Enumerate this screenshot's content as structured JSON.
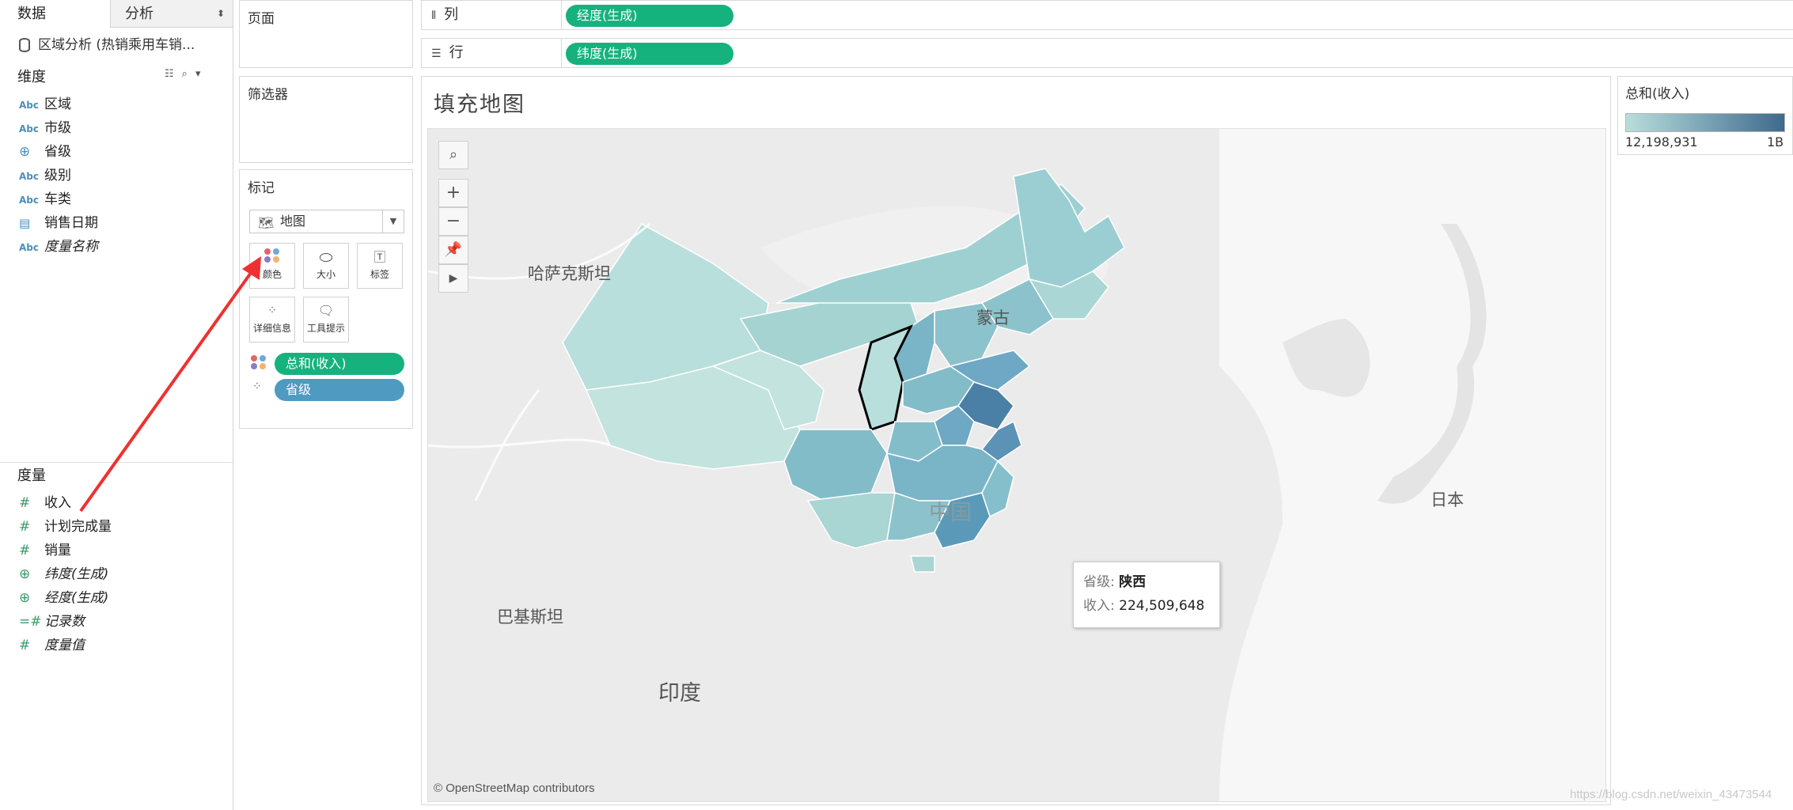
{
  "data_pane": {
    "tabs": [
      {
        "label": "数据"
      },
      {
        "label": "分析"
      }
    ],
    "datasource": "区域分析 (热销乘用车销...",
    "dimensions_title": "维度",
    "dimensions": [
      {
        "type": "Abc",
        "label": "区域"
      },
      {
        "type": "Abc",
        "label": "市级"
      },
      {
        "type": "geo",
        "label": "省级"
      },
      {
        "type": "Abc",
        "label": "级别"
      },
      {
        "type": "Abc",
        "label": "车类"
      },
      {
        "type": "date",
        "label": "销售日期"
      },
      {
        "type": "Abc",
        "label": "度量名称"
      }
    ],
    "measures_title": "度量",
    "measures": [
      {
        "type": "#",
        "label": "收入"
      },
      {
        "type": "#",
        "label": "计划完成量"
      },
      {
        "type": "#",
        "label": "销量"
      },
      {
        "type": "geo",
        "label": "纬度(生成)"
      },
      {
        "type": "geo",
        "label": "经度(生成)"
      },
      {
        "type": "=#",
        "label": "记录数"
      },
      {
        "type": "#",
        "label": "度量值"
      }
    ]
  },
  "cards": {
    "pages": "页面",
    "filters": "筛选器",
    "marks": "标记",
    "mark_type": "地图",
    "mark_buttons": [
      {
        "icon": "color",
        "label": "颜色"
      },
      {
        "icon": "size",
        "label": "大小"
      },
      {
        "icon": "text",
        "label": "标签"
      },
      {
        "icon": "detail",
        "label": "详细信息"
      },
      {
        "icon": "tooltip",
        "label": "工具提示"
      }
    ],
    "mark_pills": [
      {
        "label": "总和(收入)",
        "color": "#15b27e"
      },
      {
        "label": "省级",
        "color": "#4f9ac0"
      }
    ]
  },
  "shelves": {
    "columns": {
      "label": "列",
      "pill": "经度(生成)"
    },
    "rows": {
      "label": "行",
      "pill": "纬度(生成)"
    }
  },
  "sheet": {
    "title": "填充地图",
    "map_labels": [
      "哈萨克斯坦",
      "蒙古",
      "中国",
      "日本",
      "巴基斯坦",
      "印度"
    ],
    "attribution": "© OpenStreetMap contributors",
    "tooltip": {
      "key1": "省级:",
      "val1": "陕西",
      "key2": "收入:",
      "val2": "224,509,648"
    }
  },
  "legend": {
    "title": "总和(收入)",
    "min": "12,198,931",
    "max": "1B",
    "color_low": "#b8dedc",
    "color_high": "#3e6a8e"
  },
  "watermark": "https://blog.csdn.net/weixin_43473544"
}
